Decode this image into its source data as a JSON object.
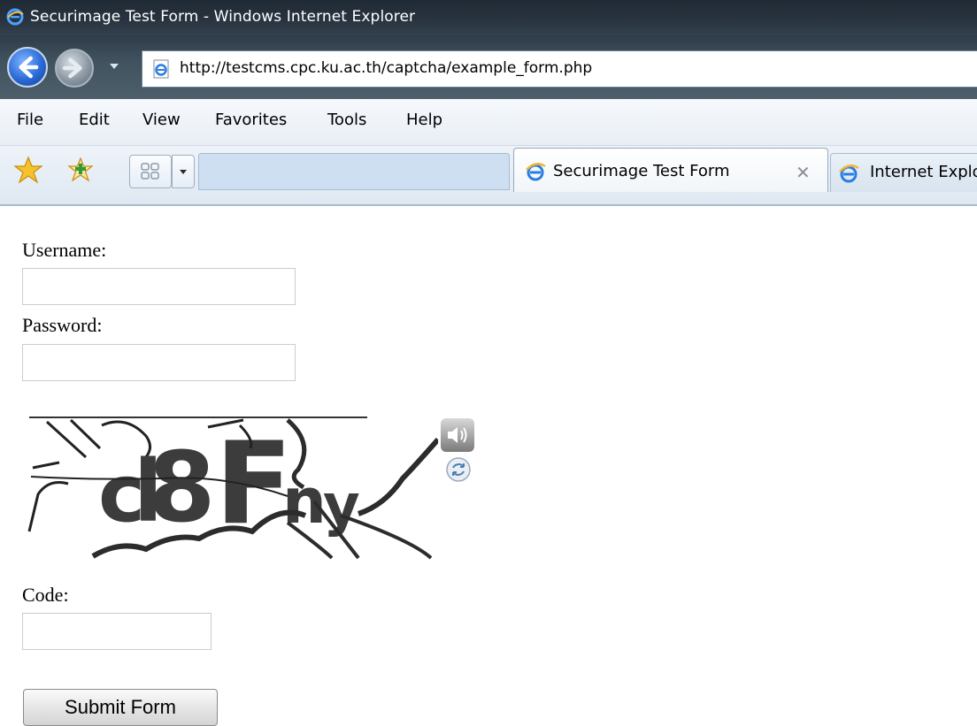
{
  "window": {
    "title": "Securimage Test Form - Windows Internet Explorer"
  },
  "address_bar": {
    "url": "http://testcms.cpc.ku.ac.th/captcha/example_form.php"
  },
  "menu": {
    "items": [
      "File",
      "Edit",
      "View",
      "Favorites",
      "Tools",
      "Help"
    ]
  },
  "tabs": {
    "active": {
      "label": "Securimage Test Form",
      "close": "✕"
    },
    "second": {
      "label": "Internet Explorer"
    }
  },
  "form": {
    "username_label": "Username:",
    "username_value": "",
    "password_label": "Password:",
    "password_value": "",
    "code_label": "Code:",
    "code_value": "",
    "submit_label": "Submit Form"
  },
  "captcha": {
    "text": "cl8Fny"
  },
  "icons": {
    "back": "back-arrow-icon",
    "forward": "forward-arrow-icon",
    "audio": "speaker-icon",
    "refresh": "refresh-icon"
  }
}
